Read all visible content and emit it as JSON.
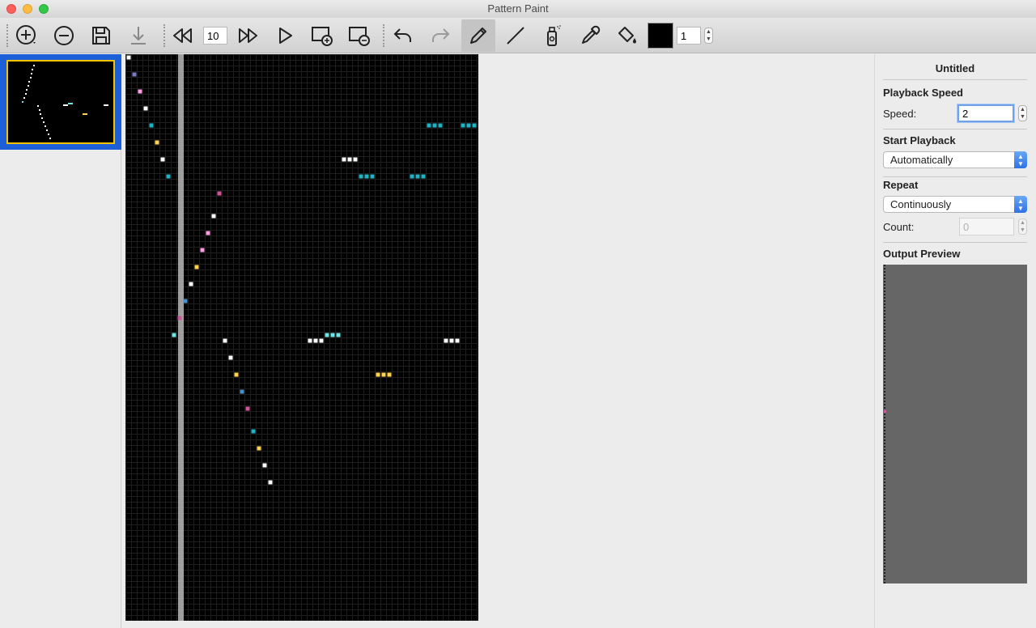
{
  "window": {
    "title": "Pattern Paint"
  },
  "toolbar": {
    "frame_count_value": "10",
    "brush_size_value": "1",
    "current_color": "#000000",
    "buttons": [
      {
        "name": "add-frame-button",
        "icon": "plus-circle-icon"
      },
      {
        "name": "remove-frame-button",
        "icon": "minus-circle-icon"
      },
      {
        "name": "save-button",
        "icon": "floppy-disk-icon"
      },
      {
        "name": "export-button",
        "icon": "download-icon"
      },
      {
        "name": "rewind-button",
        "icon": "rewind-icon"
      },
      {
        "name": "fast-forward-button",
        "icon": "fast-forward-icon"
      },
      {
        "name": "play-button",
        "icon": "play-icon"
      },
      {
        "name": "add-layer-button",
        "icon": "layer-add-icon"
      },
      {
        "name": "remove-layer-button",
        "icon": "layer-remove-icon"
      },
      {
        "name": "undo-button",
        "icon": "undo-icon"
      },
      {
        "name": "redo-button",
        "icon": "redo-icon"
      },
      {
        "name": "pencil-tool",
        "icon": "pencil-icon",
        "active": true
      },
      {
        "name": "line-tool",
        "icon": "line-icon"
      },
      {
        "name": "spray-tool",
        "icon": "spray-can-icon"
      },
      {
        "name": "eyedropper-tool",
        "icon": "eyedropper-icon"
      },
      {
        "name": "fill-tool",
        "icon": "paint-bucket-icon"
      }
    ]
  },
  "inspector": {
    "document_title": "Untitled",
    "playback_speed_heading": "Playback Speed",
    "speed_label": "Speed:",
    "speed_value": "2",
    "start_playback_heading": "Start Playback",
    "start_playback_value": "Automatically",
    "repeat_heading": "Repeat",
    "repeat_value": "Continuously",
    "count_label": "Count:",
    "count_value": "0",
    "output_preview_heading": "Output Preview"
  },
  "colors": {
    "selection": "#1d5fd6",
    "frame_border": "#f5c400",
    "pixel_white": "#ffffff",
    "pixel_teal": "#1fb3c6",
    "pixel_cyan": "#6ee6e6",
    "pixel_pink": "#ff9ee6",
    "pixel_magenta": "#d0549a",
    "pixel_yellow": "#ffd34a",
    "pixel_blue": "#4a8fc6",
    "pixel_purple": "#7a7ac6"
  }
}
